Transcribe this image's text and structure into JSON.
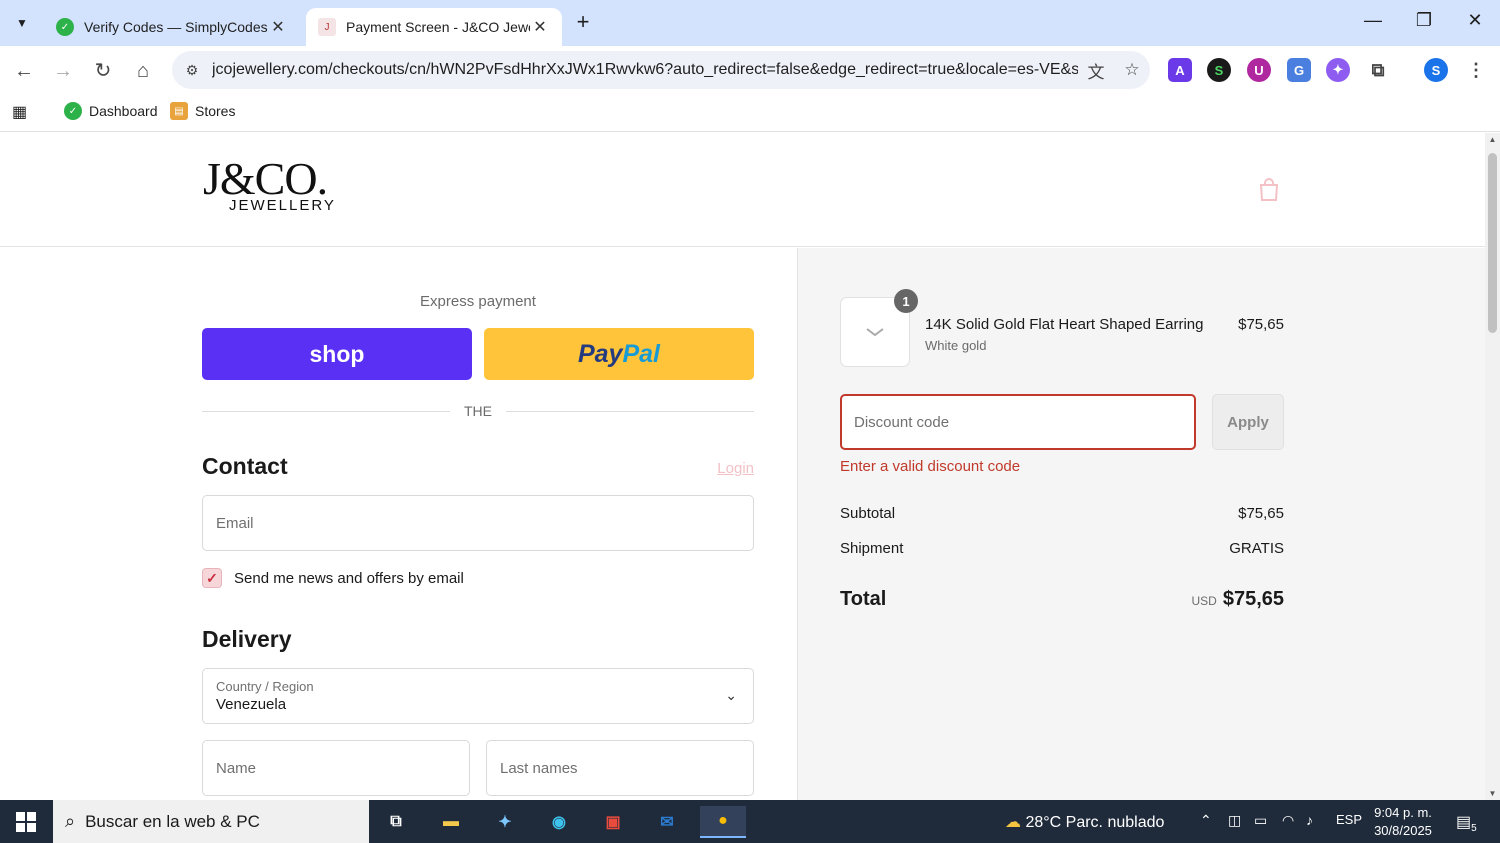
{
  "browser": {
    "tabs": [
      {
        "title": "Verify Codes — SimplyCodes",
        "active": false
      },
      {
        "title": "Payment Screen - J&CO Jewelle",
        "active": true
      }
    ],
    "url": "jcojewellery.com/checkouts/cn/hWN2PvFsdHhrXxJWx1Rwvkw6?auto_redirect=false&edge_redirect=true&locale=es-VE&ski...",
    "bookmarks": [
      "Dashboard",
      "Stores"
    ],
    "profile_initial": "S",
    "extensions": [
      "A",
      "S",
      "U",
      "G",
      "✦"
    ]
  },
  "store": {
    "logo_main": "J&CO.",
    "logo_sub": "JEWELLERY"
  },
  "checkout": {
    "express_label": "Express payment",
    "shop_label": "shop",
    "paypal_label_1": "Pay",
    "paypal_label_2": "Pal",
    "divider_text": "THE",
    "contact_heading": "Contact",
    "login_label": "Login",
    "email_placeholder": "Email",
    "newsletter_label": "Send me news and offers by email",
    "delivery_heading": "Delivery",
    "country_label": "Country / Region",
    "country_value": "Venezuela",
    "name_placeholder": "Name",
    "last_name_placeholder": "Last names"
  },
  "summary": {
    "quantity": "1",
    "product_name": "14K Solid Gold Flat Heart Shaped Earring",
    "product_variant": "White gold",
    "product_price": "$75,65",
    "discount_placeholder": "Discount code",
    "apply_label": "Apply",
    "discount_error": "Enter a valid discount code",
    "subtotal_label": "Subtotal",
    "subtotal_value": "$75,65",
    "shipment_label": "Shipment",
    "shipment_value": "GRATIS",
    "total_label": "Total",
    "total_currency": "USD",
    "total_value": "$75,65"
  },
  "taskbar": {
    "search_text": "Buscar en la web & PC",
    "weather": "28°C  Parc. nublado",
    "language": "ESP",
    "time": "9:04 p. m.",
    "date": "30/8/2025",
    "notifications": "5"
  },
  "colors": {
    "shop_purple": "#5a31f4",
    "paypal_yellow": "#ffc439",
    "error_red": "#c0392b",
    "accent_pink": "#f3c1c6",
    "chrome_blue": "#d3e3fd"
  }
}
